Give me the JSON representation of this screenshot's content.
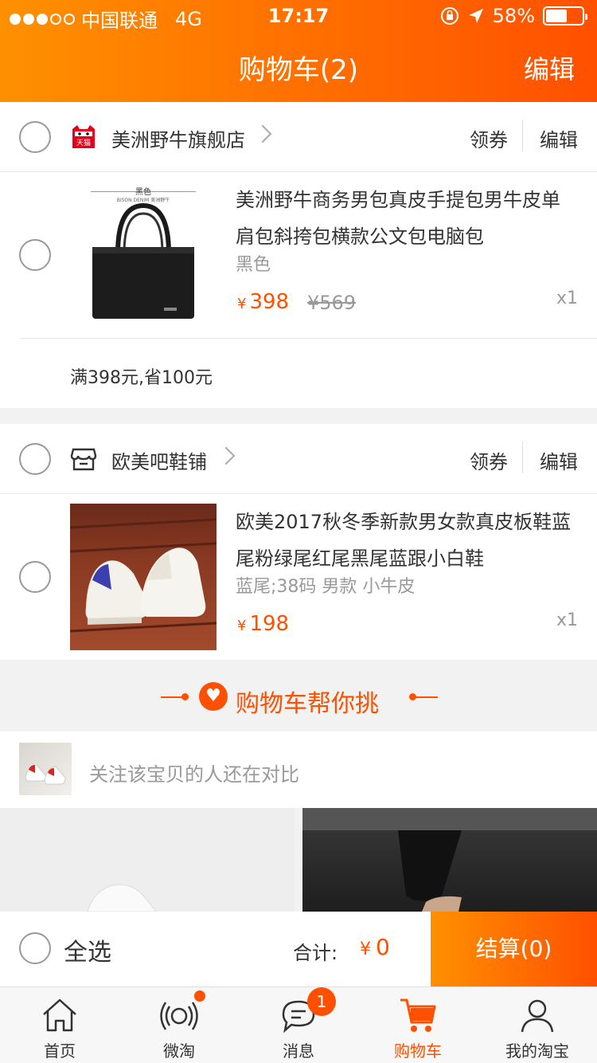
{
  "status_bar": {
    "carrier": "中国联通",
    "network": "4G",
    "time": "17:17",
    "battery": "58%",
    "battery_level": 0.58
  },
  "header": {
    "title": "购物车(2)",
    "edit_label": "编辑"
  },
  "shops": [
    {
      "name": "美洲野牛旗舰店",
      "coupon_label": "领券",
      "edit_label": "编辑",
      "badge_text": "天猫",
      "item": {
        "image_label": "黑色",
        "image_brand": "BISON DENIM 美洲野牛",
        "title": "美洲野牛商务男包真皮手提包男牛皮单肩包斜挎包横款公文包电脑包",
        "sku": "黑色",
        "currency": "¥",
        "price": "398",
        "original_price": "¥569",
        "quantity": "x1"
      },
      "promo": "满398元,省100元"
    },
    {
      "name": "欧美吧鞋铺",
      "coupon_label": "领券",
      "edit_label": "编辑",
      "item": {
        "title": "欧美2017秋冬季新款男女款真皮板鞋蓝尾粉绿尾红尾黑尾蓝跟小白鞋",
        "sku": "蓝尾;38码 男款 小牛皮",
        "currency": "¥",
        "price": "198",
        "quantity": "x1"
      }
    }
  ],
  "helper": {
    "title": "购物车帮你挑",
    "compare_text": "关注该宝贝的人还在对比"
  },
  "bottom_bar": {
    "select_all": "全选",
    "total_label": "合计:",
    "currency": "¥",
    "total_value": "0",
    "checkout_label": "结算(0)"
  },
  "tabs": [
    {
      "label": "首页",
      "icon": "home-icon"
    },
    {
      "label": "微淘",
      "icon": "broadcast-icon"
    },
    {
      "label": "消息",
      "icon": "message-icon",
      "badge": "1"
    },
    {
      "label": "购物车",
      "icon": "cart-icon",
      "active": true
    },
    {
      "label": "我的淘宝",
      "icon": "user-icon"
    }
  ],
  "colors": {
    "accent": "#ff5000",
    "accent_light": "#ff9000"
  }
}
